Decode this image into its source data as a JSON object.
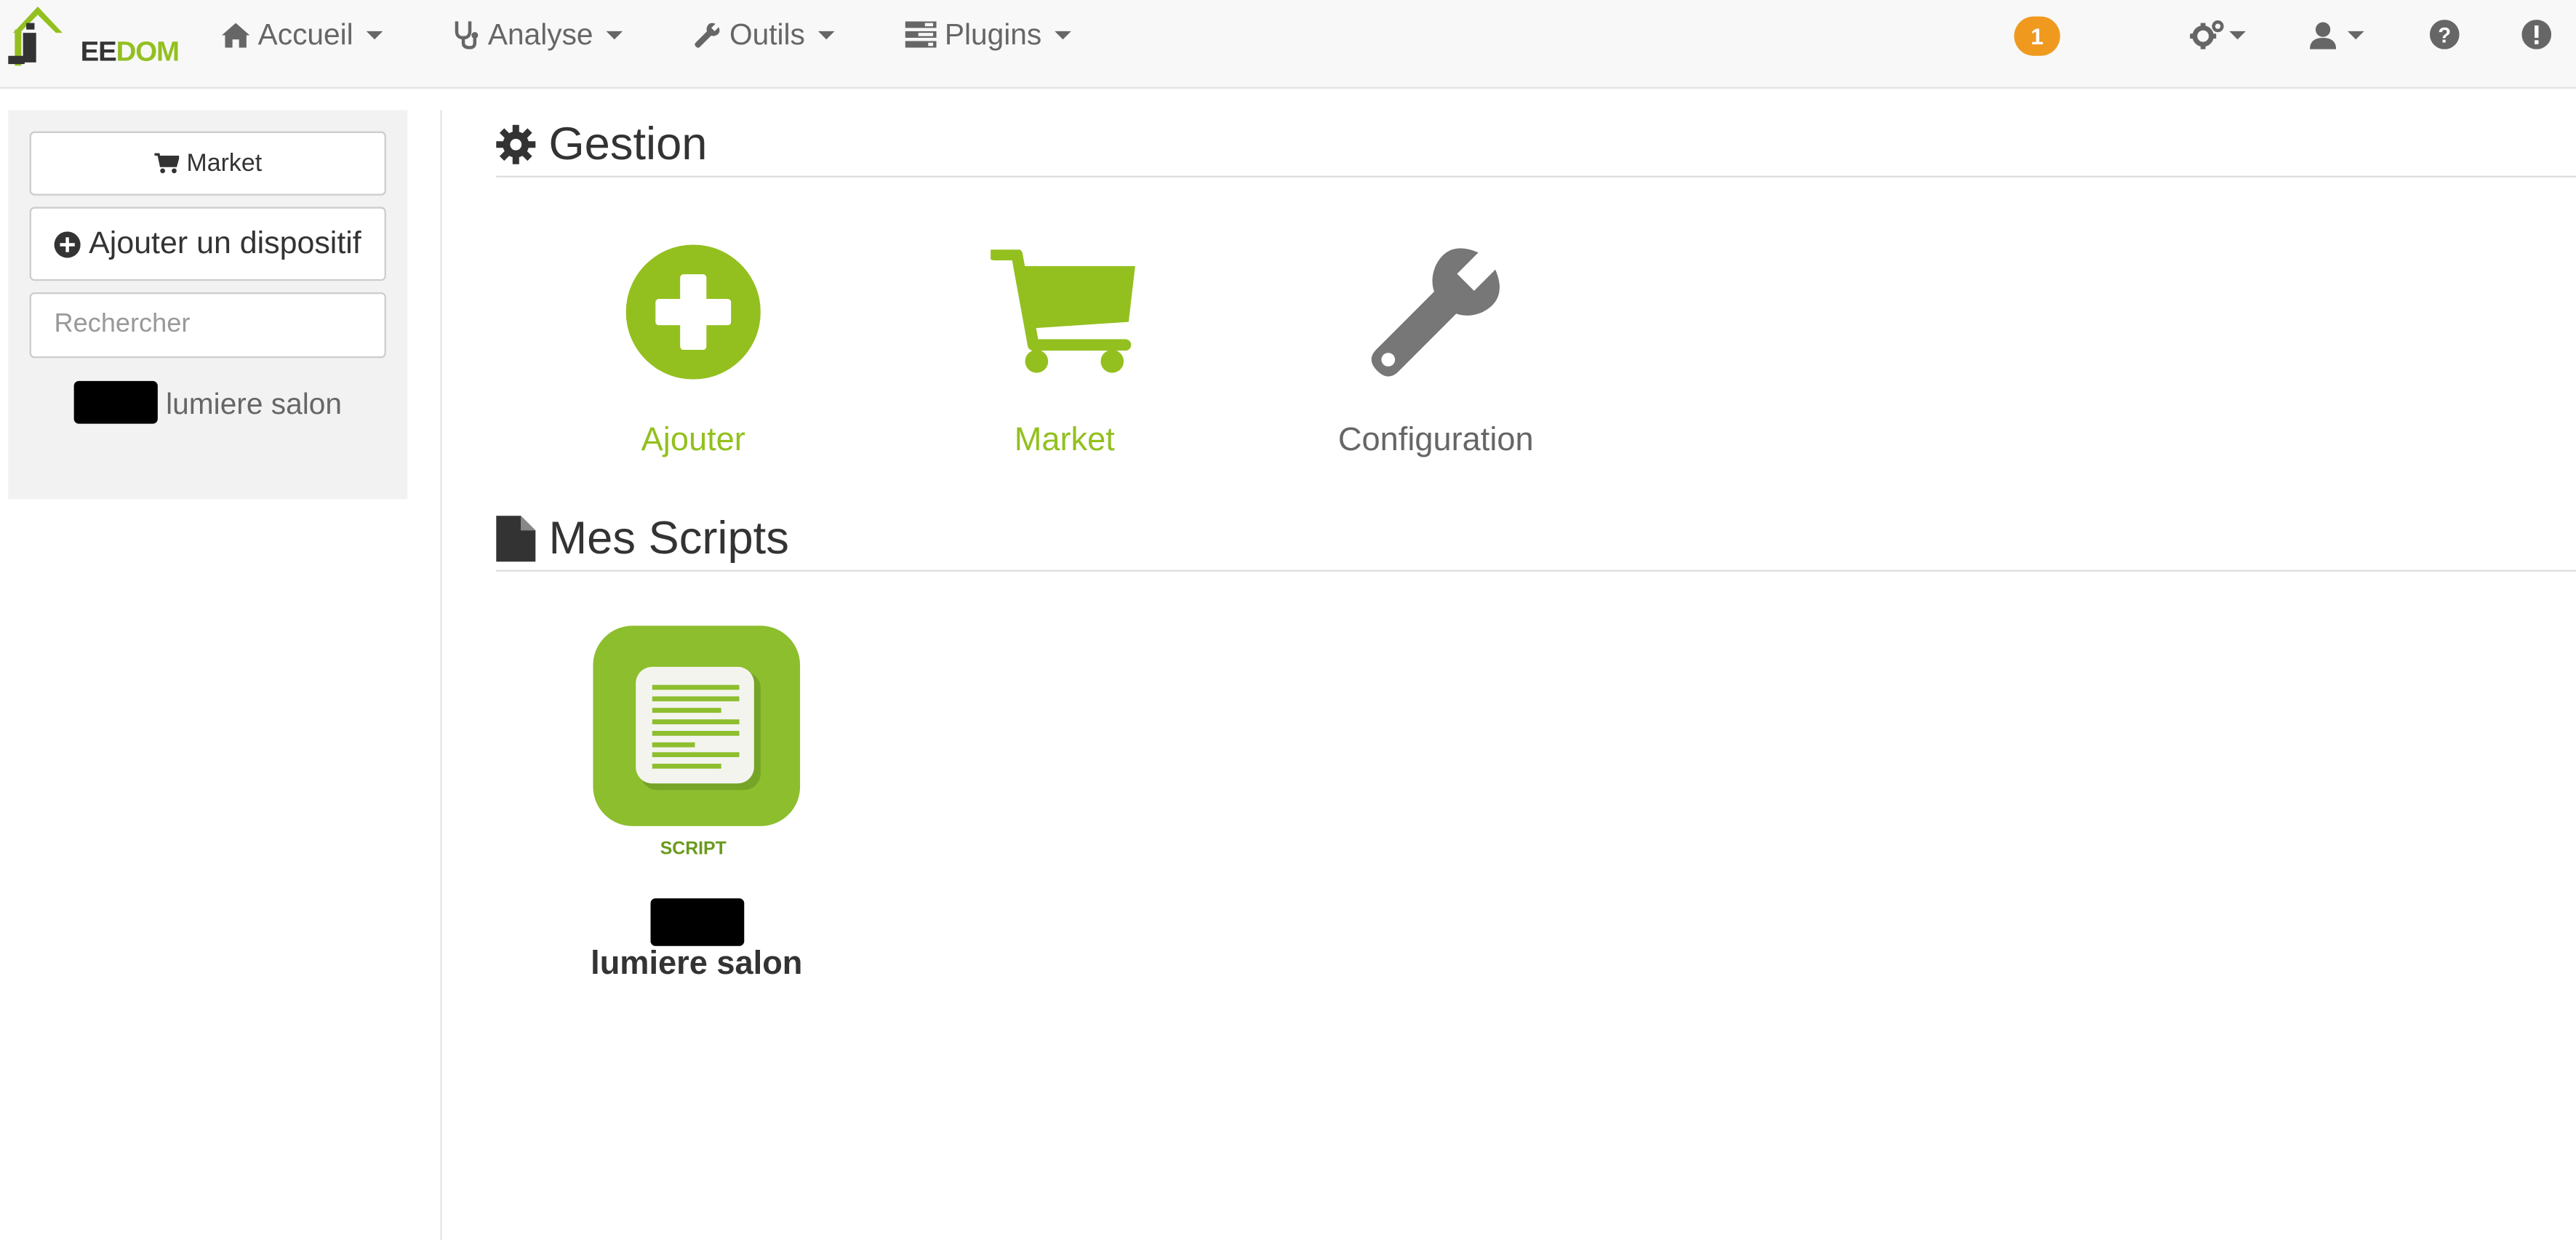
{
  "colors": {
    "brand_green": "#93c01f",
    "badge_orange": "#ef9a1e",
    "icon_grey": "#777777",
    "navbar_bg": "#f8f8f8"
  },
  "navbar": {
    "logo_text_dark": "EE",
    "logo_text_green": "DOM",
    "logo_icon": "house-j-logo-icon",
    "items": [
      {
        "label": "Accueil",
        "icon": "home-icon"
      },
      {
        "label": "Analyse",
        "icon": "stethoscope-icon"
      },
      {
        "label": "Outils",
        "icon": "wrench-icon"
      },
      {
        "label": "Plugins",
        "icon": "tasks-icon"
      }
    ],
    "notification_count": "1",
    "right_icons": [
      "cogs-icon",
      "user-icon",
      "question-icon",
      "exclamation-icon"
    ]
  },
  "sidebar": {
    "market_label": "Market",
    "add_label": "Ajouter un dispositif",
    "search_placeholder": "Rechercher",
    "items": [
      {
        "label": "lumiere salon"
      }
    ]
  },
  "main": {
    "gestion_title": "Gestion",
    "tiles": [
      {
        "label": "Ajouter",
        "icon": "plus-circle-icon"
      },
      {
        "label": "Market",
        "icon": "shopping-cart-icon"
      },
      {
        "label": "Configuration",
        "icon": "wrench-icon"
      }
    ],
    "scripts_title": "Mes Scripts",
    "scripts": [
      {
        "name": "lumiere salon",
        "badge_text": "SCRIPT",
        "icon": "script-document-icon"
      }
    ]
  }
}
